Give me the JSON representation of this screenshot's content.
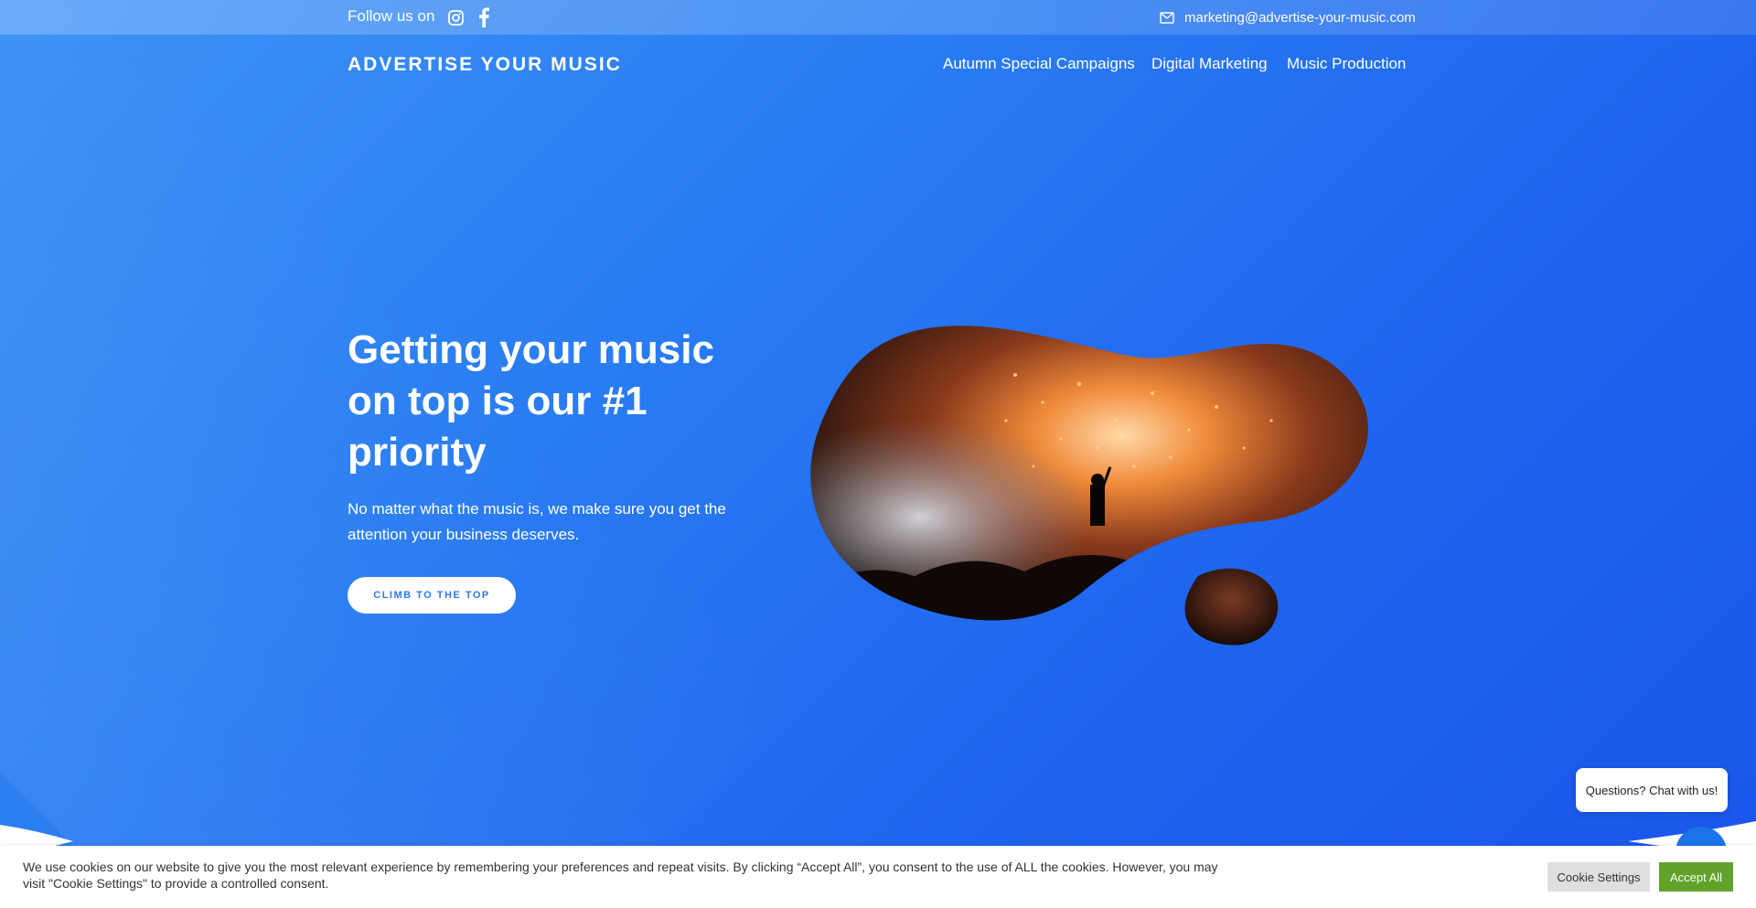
{
  "topbar": {
    "follow_text": "Follow us on",
    "social_icons": [
      "instagram-icon",
      "facebook-icon"
    ],
    "mail_icon": "mail-icon",
    "email": "marketing@advertise-your-music.com"
  },
  "header": {
    "logo": "ADVERTISE YOUR MUSIC",
    "nav": [
      "Autumn Special Campaigns",
      "Digital Marketing",
      "Music Production"
    ]
  },
  "hero": {
    "headline": "Getting your music on top is our #1 priority",
    "subtext": "No matter what the music is, we make sure you get the attention your business deserves.",
    "cta": "CLIMB TO THE TOP"
  },
  "chat": {
    "bubble": "Questions? Chat with us!"
  },
  "cookie_banner": {
    "text": "We use cookies on our website to give you the most relevant experience by remembering your preferences and repeat visits. By clicking “Accept All”, you consent to the use of ALL the cookies. However, you may visit \"Cookie Settings\" to provide a controlled consent.",
    "settings_label": "Cookie Settings",
    "accept_label": "Accept All"
  },
  "colors": {
    "accent": "#2a7cf0",
    "accept_green": "#61a229"
  }
}
